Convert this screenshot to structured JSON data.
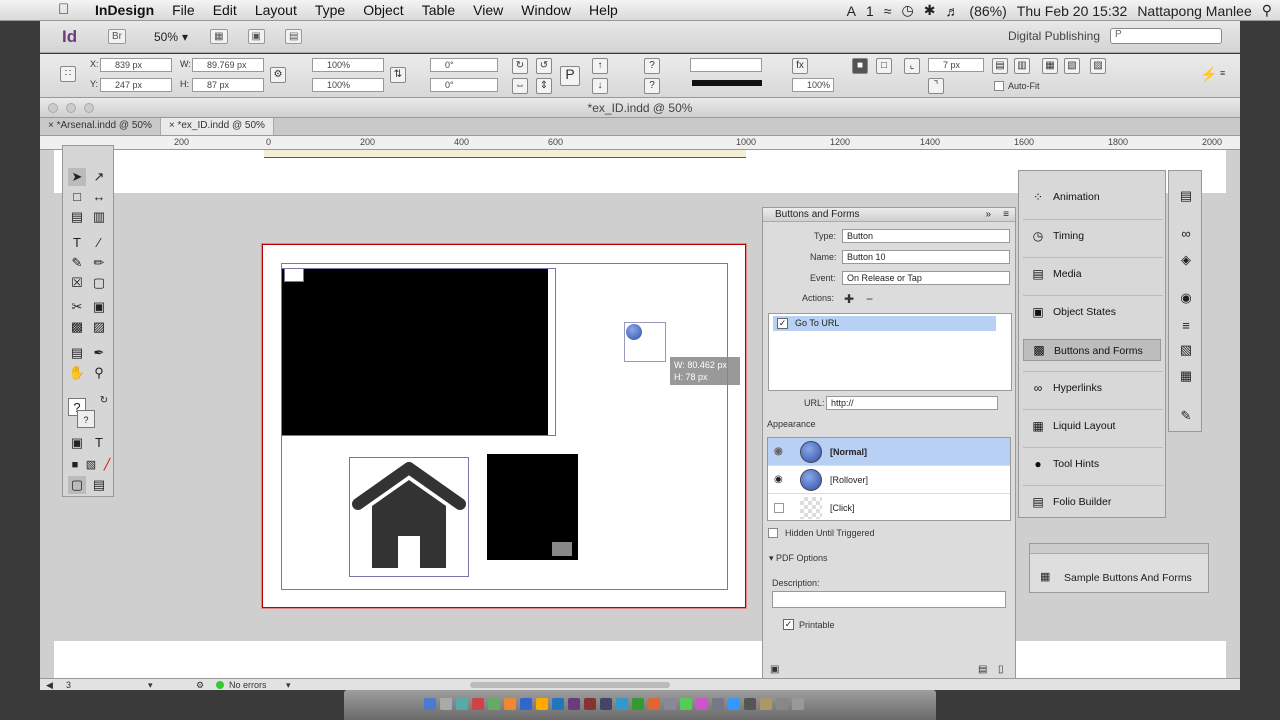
{
  "menubar": {
    "app": "InDesign",
    "items": [
      "File",
      "Edit",
      "Layout",
      "Type",
      "Object",
      "Table",
      "View",
      "Window",
      "Help"
    ],
    "status_ai": "1",
    "battery": "(86%)",
    "clock": "Thu Feb 20  15:32",
    "user": "Nattapong Manlee"
  },
  "appbar": {
    "logo": "Id",
    "bridge": "Br",
    "zoom": "50%",
    "workspace": "Digital Publishing",
    "search_placeholder": "P"
  },
  "control": {
    "x_label": "X:",
    "x_value": "839 px",
    "y_label": "Y:",
    "y_value": "247 px",
    "w_label": "W:",
    "w_value": "89.769 px",
    "h_label": "H:",
    "h_value": "87 px",
    "scale_x": "100%",
    "scale_y": "100%",
    "rotate": "0°",
    "shear": "0°",
    "stroke_pct": "100%",
    "corner": "7 px",
    "autofit": "Auto-Fit"
  },
  "document": {
    "title": "*ex_ID.indd @ 50%",
    "tabs": [
      "*Arsenal.indd @ 50%",
      "*ex_ID.indd @ 50%"
    ],
    "ruler_ticks": [
      "200",
      "0",
      "200",
      "400",
      "600",
      "1000",
      "1200",
      "1400",
      "1600",
      "1800",
      "2000"
    ],
    "tooltip_w": "W: 80.462 px",
    "tooltip_h": "H: 78 px"
  },
  "buttons_forms": {
    "title": "Buttons and Forms",
    "type_label": "Type:",
    "type_value": "Button",
    "name_label": "Name:",
    "name_value": "Button 10",
    "event_label": "Event:",
    "event_value": "On Release or Tap",
    "actions_label": "Actions:",
    "action_item": "Go To URL",
    "url_label": "URL:",
    "url_value": "http://",
    "appearance_label": "Appearance",
    "states": [
      "[Normal]",
      "[Rollover]",
      "[Click]"
    ],
    "hidden_label": "Hidden Until Triggered",
    "pdf_options": "PDF Options",
    "description_label": "Description:",
    "printable_label": "Printable"
  },
  "side_panels": {
    "items": [
      "Animation",
      "Timing",
      "Media",
      "Object States",
      "Buttons and Forms",
      "Hyperlinks",
      "Liquid Layout",
      "Tool Hints",
      "Folio Builder"
    ],
    "active": "Buttons and Forms",
    "sample": "Sample Buttons And Forms"
  },
  "statusbar": {
    "page": "3",
    "errors": "No errors"
  },
  "colors": {
    "selection_blue": "#b8d0f3",
    "indesign_purple": "#6b3b7d",
    "page_border": "#bb0000"
  }
}
